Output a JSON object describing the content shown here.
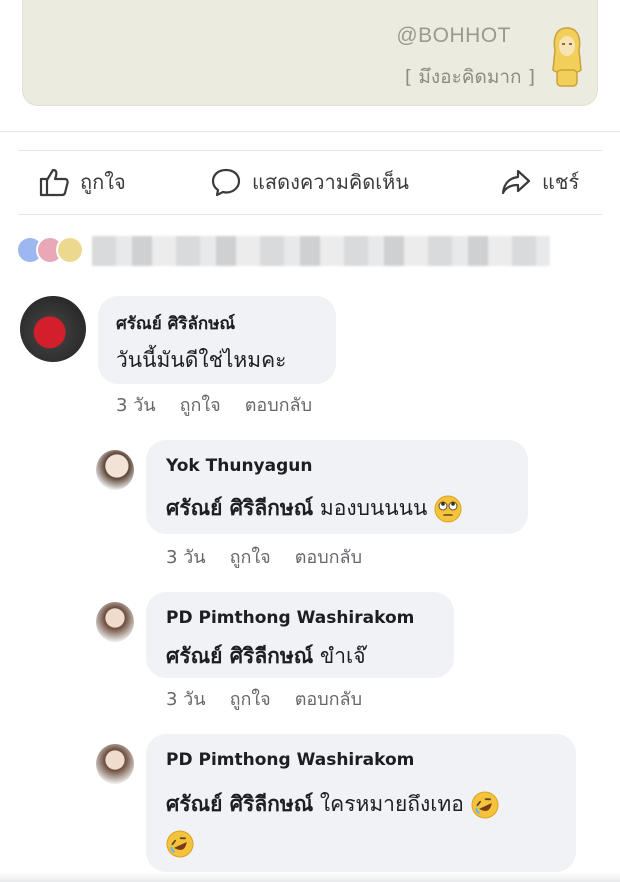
{
  "post_image": {
    "watermark": "@BOHHOT",
    "caption": "[ มึงอะคิดมาก ]"
  },
  "actions": {
    "like": "ถูกใจ",
    "comment": "แสดงความคิดเห็น",
    "share": "แชร์"
  },
  "reaction_colors": [
    "#9db8f0",
    "#eaa7b8",
    "#ecd98f"
  ],
  "comments": [
    {
      "name": "ศรัณย์ ศิริลักษณ์",
      "text": "วันนี้มันดีใช่ไหมคะ",
      "time": "3 วัน",
      "like": "ถูกใจ",
      "reply": "ตอบกลับ"
    },
    {
      "name": "Yok Thunyagun",
      "mention": "ศรัณย์ ศิริลีกษณ์",
      "text": " มองบนนนน",
      "emoji": "eye-roll-emoji",
      "time": "3 วัน",
      "like": "ถูกใจ",
      "reply": "ตอบกลับ"
    },
    {
      "name": "PD Pimthong Washirakom",
      "mention": "ศรัณย์ ศิริลีกษณ์",
      "text": " ขำเจ๊",
      "time": "3 วัน",
      "like": "ถูกใจ",
      "reply": "ตอบกลับ"
    },
    {
      "name": "PD Pimthong Washirakom",
      "mention": "ศรัณย์ ศิริลีกษณ์",
      "text": " ใครหมายถึงเทอ",
      "emoji": "rofl-emoji"
    }
  ]
}
